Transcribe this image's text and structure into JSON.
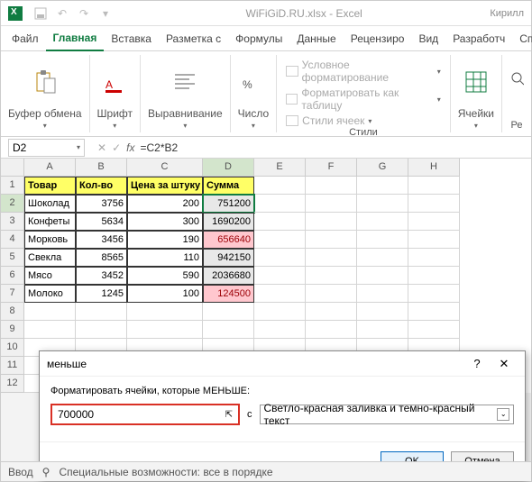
{
  "titlebar": {
    "filename": "WiFiGiD.RU.xlsx - Excel",
    "user": "Кирилл"
  },
  "menu": {
    "file": "Файл",
    "home": "Главная",
    "insert": "Вставка",
    "layout": "Разметка с",
    "formulas": "Формулы",
    "data": "Данные",
    "review": "Рецензиро",
    "view": "Вид",
    "developer": "Разработч",
    "help": "Спр"
  },
  "ribbon": {
    "clipboard": "Буфер обмена",
    "font": "Шрифт",
    "alignment": "Выравнивание",
    "number": "Число",
    "cond_format": "Условное форматирование",
    "format_table": "Форматировать как таблицу",
    "cell_styles": "Стили ячеек",
    "styles": "Стили",
    "cells": "Ячейки",
    "editing": "Ре"
  },
  "namebox": "D2",
  "formula": "=C2*B2",
  "columns": [
    "A",
    "B",
    "C",
    "D",
    "E",
    "F",
    "G",
    "H"
  ],
  "headers": {
    "a": "Товар",
    "b": "Кол-во",
    "c": "Цена за штуку",
    "d": "Сумма"
  },
  "rows": [
    {
      "n": 2,
      "a": "Шоколад",
      "b": "3756",
      "c": "200",
      "d": "751200",
      "red": false,
      "sel": true
    },
    {
      "n": 3,
      "a": "Конфеты",
      "b": "5634",
      "c": "300",
      "d": "1690200",
      "red": false
    },
    {
      "n": 4,
      "a": "Морковь",
      "b": "3456",
      "c": "190",
      "d": "656640",
      "red": true
    },
    {
      "n": 5,
      "a": "Свекла",
      "b": "8565",
      "c": "110",
      "d": "942150",
      "red": false
    },
    {
      "n": 6,
      "a": "Мясо",
      "b": "3452",
      "c": "590",
      "d": "2036680",
      "red": false
    },
    {
      "n": 7,
      "a": "Молоко",
      "b": "1245",
      "c": "100",
      "d": "124500",
      "red": true
    }
  ],
  "empty_rows": [
    8,
    9,
    10,
    11,
    12
  ],
  "dialog": {
    "title": "меньше",
    "label": "Форматировать ячейки, которые МЕНЬШЕ:",
    "value": "700000",
    "with": "с",
    "format": "Светло-красная заливка и темно-красный текст",
    "ok": "OK",
    "cancel": "Отмена"
  },
  "status": {
    "input": "Ввод",
    "access": "Специальные возможности: все в порядке"
  }
}
